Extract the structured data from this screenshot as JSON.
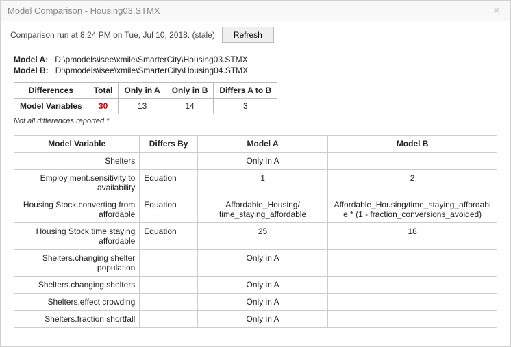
{
  "title": "Model Comparison - Housing03.STMX",
  "runline": {
    "text": "Comparison run at 8:24 PM on Tue, Jul 10, 2018.  (stale)",
    "refresh_label": "Refresh"
  },
  "models": {
    "label_a": "Model A:",
    "path_a": "D:\\pmodels\\isee\\xmile\\SmarterCity\\Housing03.STMX",
    "label_b": "Model B:",
    "path_b": "D:\\pmodels\\isee\\xmile\\SmarterCity\\Housing04.STMX"
  },
  "summary": {
    "headers": {
      "differences": "Differences",
      "total": "Total",
      "only_a": "Only in A",
      "only_b": "Only in B",
      "differs": "Differs A to B"
    },
    "row": {
      "label": "Model Variables",
      "total": "30",
      "only_a": "13",
      "only_b": "14",
      "differs": "3"
    }
  },
  "note": "Not all differences reported *",
  "detail": {
    "headers": {
      "variable": "Model Variable",
      "differs_by": "Differs By",
      "model_a": "Model A",
      "model_b": "Model B"
    },
    "rows": [
      {
        "variable": "Shelters",
        "differs_by": "",
        "a": "Only in A",
        "b": ""
      },
      {
        "variable": "Employ ment.sensitivity to availability",
        "differs_by": "Equation",
        "a": "1",
        "b": "2"
      },
      {
        "variable": "Housing Stock.converting from affordable",
        "differs_by": "Equation",
        "a": "Affordable_Housing/ time_staying_affordable",
        "b": "Affordable_Housing/time_staying_affordable * (1 - fraction_conversions_avoided)"
      },
      {
        "variable": "Housing Stock.time staying affordable",
        "differs_by": "Equation",
        "a": "25",
        "b": "18"
      },
      {
        "variable": "Shelters.changing shelter population",
        "differs_by": "",
        "a": "Only in A",
        "b": ""
      },
      {
        "variable": "Shelters.changing shelters",
        "differs_by": "",
        "a": "Only in A",
        "b": ""
      },
      {
        "variable": "Shelters.effect crowding",
        "differs_by": "",
        "a": "Only in A",
        "b": ""
      },
      {
        "variable": "Shelters.fraction shortfall",
        "differs_by": "",
        "a": "Only in A",
        "b": ""
      }
    ]
  }
}
